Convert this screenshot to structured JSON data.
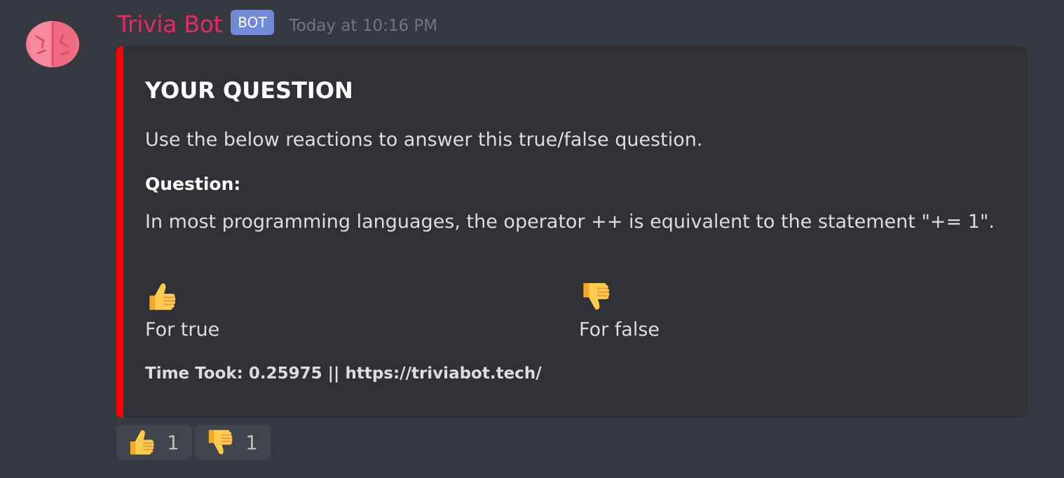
{
  "author": {
    "name": "Trivia Bot",
    "tag": "BOT",
    "timestamp": "Today at 10:16 PM",
    "avatar_icon": "brain-icon",
    "name_color": "#e9286c"
  },
  "embed": {
    "accent_color": "#ff0000",
    "title": "YOUR QUESTION",
    "description": "Use the below reactions to answer this true/false question.",
    "field": {
      "name": "Question:",
      "value": "In most programming languages, the operator ++ is equivalent to the statement \"+= 1\"."
    },
    "options": [
      {
        "icon": "thumbs-up-icon",
        "label": "For true"
      },
      {
        "icon": "thumbs-down-icon",
        "label": "For false"
      }
    ],
    "footer": "Time Took: 0.25975 || https://triviabot.tech/"
  },
  "reactions": [
    {
      "icon": "thumbs-up-icon",
      "count": "1"
    },
    {
      "icon": "thumbs-down-icon",
      "count": "1"
    }
  ]
}
